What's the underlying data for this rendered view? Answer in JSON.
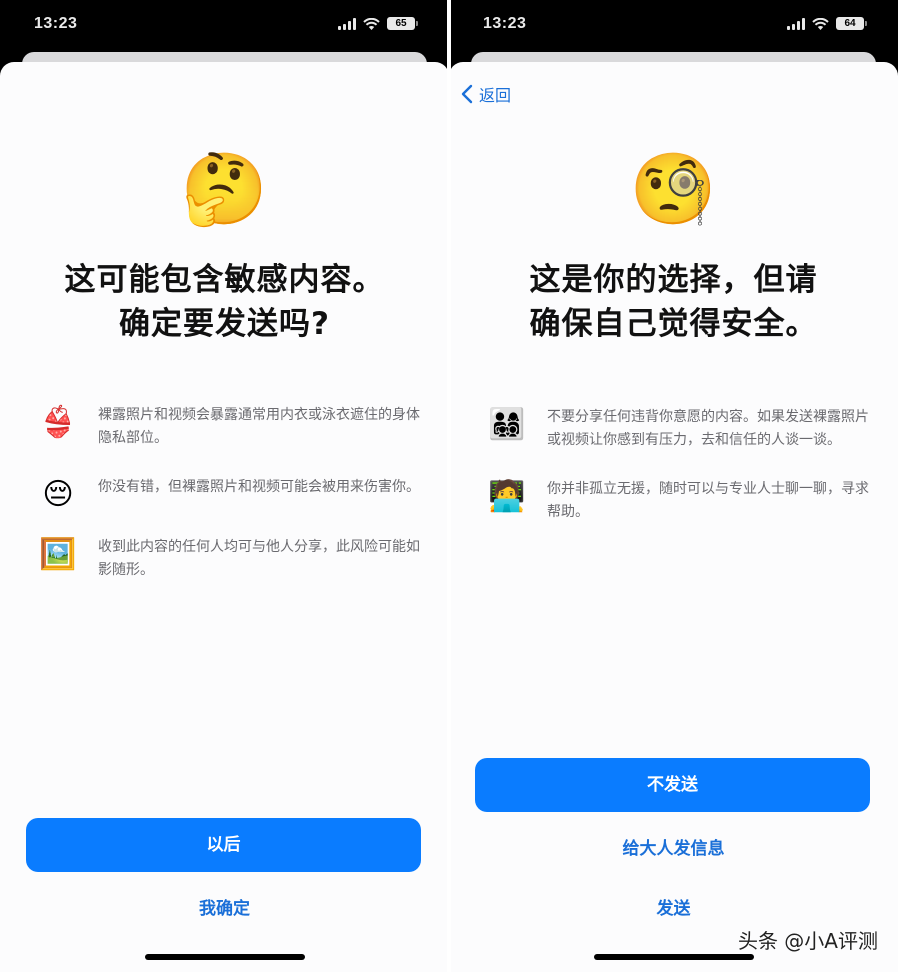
{
  "left_screen": {
    "status_bar": {
      "time": "13:23",
      "battery": "65"
    },
    "hero_emoji": "🤔",
    "title_line1": "这可能包含敏感内容。",
    "title_line2": "确定要发送吗?",
    "items": [
      {
        "icon": "👙",
        "text": "裸露照片和视频会暴露通常用内衣或泳衣遮住的身体隐私部位。"
      },
      {
        "icon": "😔",
        "text": "你没有错，但裸露照片和视频可能会被用来伤害你。"
      },
      {
        "icon": "🖼️",
        "text": "收到此内容的任何人均可与他人分享，此风险可能如影随形。"
      }
    ],
    "primary_button": "以后",
    "secondary_button": "我确定"
  },
  "right_screen": {
    "status_bar": {
      "time": "13:23",
      "battery": "64"
    },
    "back_label": "返回",
    "hero_emoji": "🧐",
    "title_line1": "这是你的选择，但请",
    "title_line2": "确保自己觉得安全。",
    "items": [
      {
        "icon": "👨‍👩‍👧‍👦",
        "text": "不要分享任何违背你意愿的内容。如果发送裸露照片或视频让你感到有压力，去和信任的人谈一谈。"
      },
      {
        "icon": "🧑‍💻",
        "text": "你并非孤立无援，随时可以与专业人士聊一聊，寻求帮助。"
      }
    ],
    "primary_button": "不发送",
    "secondary_button": "给大人发信息",
    "tertiary_button": "发送"
  },
  "watermark": "头条 @小A评测",
  "colors": {
    "accent": "#0a7cff",
    "link": "#1a6fd8",
    "body_text": "#6a6a6f"
  }
}
